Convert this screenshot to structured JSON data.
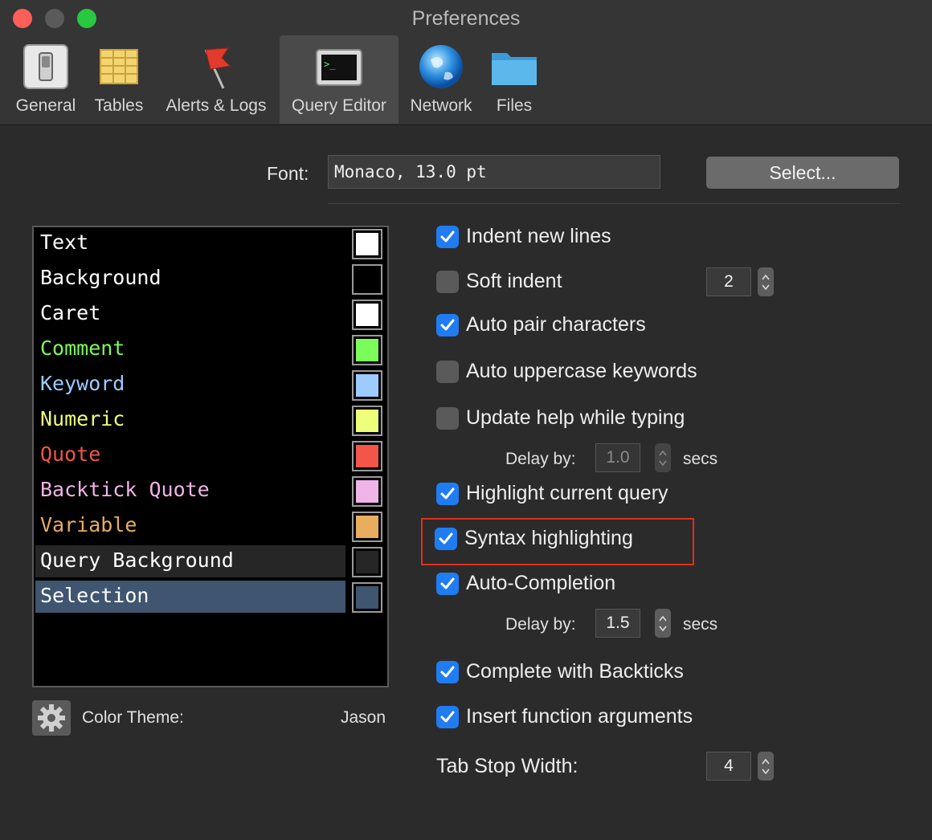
{
  "window": {
    "title": "Preferences"
  },
  "toolbar": {
    "tabs": [
      {
        "label": "General",
        "icon": "switch-icon"
      },
      {
        "label": "Tables",
        "icon": "table-icon"
      },
      {
        "label": "Alerts & Logs",
        "icon": "flag-icon"
      },
      {
        "label": "Query Editor",
        "icon": "terminal-icon",
        "selected": true
      },
      {
        "label": "Network",
        "icon": "globe-icon"
      },
      {
        "label": "Files",
        "icon": "folder-icon"
      }
    ]
  },
  "font": {
    "label": "Font:",
    "value": "Monaco, 13.0 pt",
    "select_label": "Select..."
  },
  "color_list": [
    {
      "name": "Text",
      "text_color": "#ffffff",
      "swatch": "#ffffff"
    },
    {
      "name": "Background",
      "text_color": "#ffffff",
      "swatch": "#000000"
    },
    {
      "name": "Caret",
      "text_color": "#ffffff",
      "swatch": "#ffffff"
    },
    {
      "name": "Comment",
      "text_color": "#7cfc5a",
      "swatch": "#7cfc5a"
    },
    {
      "name": "Keyword",
      "text_color": "#9ccbff",
      "swatch": "#9ccbff"
    },
    {
      "name": "Numeric",
      "text_color": "#eeff7a",
      "swatch": "#eeff7a"
    },
    {
      "name": "Quote",
      "text_color": "#f2554a",
      "swatch": "#f2554a"
    },
    {
      "name": "Backtick Quote",
      "text_color": "#f0b4e8",
      "swatch": "#f0b4e8"
    },
    {
      "name": "Variable",
      "text_color": "#e8ad5e",
      "swatch": "#e8ad5e"
    },
    {
      "name": "Query Background",
      "text_color": "#ffffff",
      "swatch": "#262626",
      "row_bg": "#262626"
    },
    {
      "name": "Selection",
      "text_color": "#ffffff",
      "swatch": "#3f5570",
      "row_bg": "#3f5570"
    }
  ],
  "theme": {
    "label": "Color Theme:",
    "value": "Jason"
  },
  "options": {
    "indent_new_lines": {
      "label": "Indent new lines",
      "checked": true
    },
    "soft_indent": {
      "label": "Soft indent",
      "checked": false,
      "value": "2"
    },
    "auto_pair": {
      "label": "Auto pair characters",
      "checked": true
    },
    "auto_uppercase": {
      "label": "Auto uppercase keywords",
      "checked": false
    },
    "update_help": {
      "label": "Update help while typing",
      "checked": false,
      "delay_label": "Delay by:",
      "delay_value": "1.0",
      "unit": "secs"
    },
    "highlight_query": {
      "label": "Highlight current query",
      "checked": true
    },
    "syntax_highlighting": {
      "label": "Syntax highlighting",
      "checked": true
    },
    "auto_completion": {
      "label": "Auto-Completion",
      "checked": true,
      "delay_label": "Delay by:",
      "delay_value": "1.5",
      "unit": "secs"
    },
    "complete_backticks": {
      "label": "Complete with Backticks",
      "checked": true
    },
    "insert_function_args": {
      "label": "Insert function arguments",
      "checked": true
    }
  },
  "tab_stop": {
    "label": "Tab Stop Width:",
    "value": "4"
  }
}
